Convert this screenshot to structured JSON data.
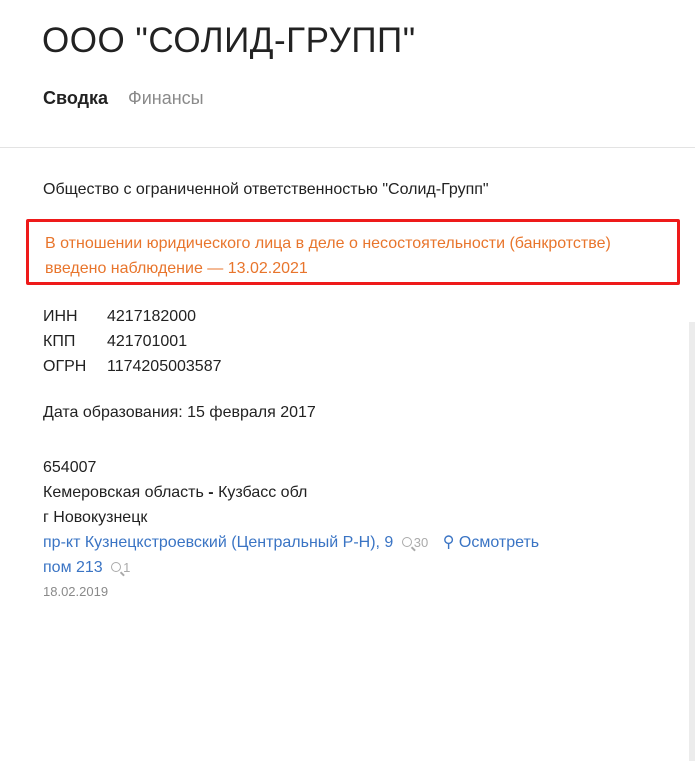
{
  "header": {
    "title": "ООО \"СОЛИД-ГРУПП\"",
    "tabs": [
      {
        "label": "Сводка",
        "active": true
      },
      {
        "label": "Финансы",
        "active": false
      }
    ]
  },
  "summary": {
    "full_name": "Общество с ограниченной ответственностью \"Солид-Групп\"",
    "alert": {
      "line1": "В отношении юридического лица в деле о несостоятельности (банкротстве)",
      "line2": "введено наблюдение — 13.02.2021",
      "text_color": "#e8752c",
      "border_color": "#ee1a1a"
    },
    "requisites": [
      {
        "label": "ИНН",
        "value": "4217182000"
      },
      {
        "label": "КПП",
        "value": "421701001"
      },
      {
        "label": "ОГРН",
        "value": "1174205003587"
      }
    ],
    "formation_date": "Дата образования: 15 февраля 2017",
    "address": {
      "postal_code": "654007",
      "region_a": "Кемеровская область",
      "region_sep": " - ",
      "region_b": "Кузбасс обл",
      "city": "г Новокузнецк",
      "street": "пр-кт Кузнецкстроевский (Центральный Р-Н), 9",
      "street_count": "30",
      "map_link": "Осмотреть",
      "room": "пом 213",
      "room_count": "1",
      "date": "18.02.2019"
    }
  }
}
